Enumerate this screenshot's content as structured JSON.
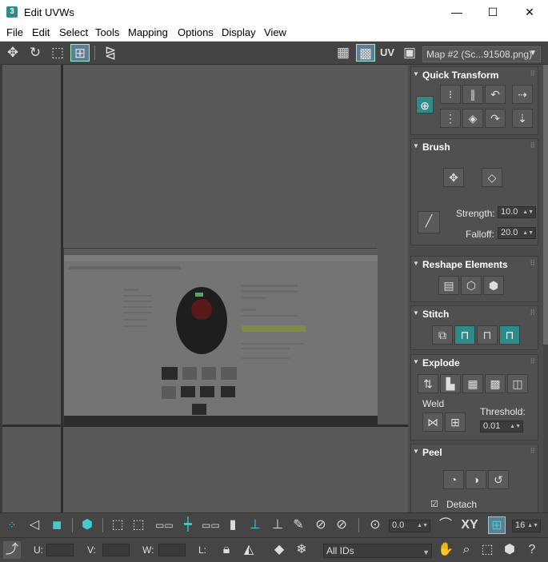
{
  "window": {
    "title": "Edit UVWs",
    "app_icon": "3",
    "minimize": "—",
    "maximize": "☐",
    "close": "✕"
  },
  "menu": [
    "File",
    "Edit",
    "Select",
    "Tools",
    "Mapping",
    "Options",
    "Display",
    "View"
  ],
  "toolbar": {
    "uv_label": "UV",
    "map_dropdown": "Map #2 (Sc...91508.png)"
  },
  "panel": {
    "quick_transform": {
      "title": "Quick Transform"
    },
    "brush": {
      "title": "Brush",
      "strength_label": "Strength:",
      "strength_value": "10.0",
      "falloff_label": "Falloff:",
      "falloff_value": "20.0"
    },
    "reshape": {
      "title": "Reshape Elements"
    },
    "stitch": {
      "title": "Stitch"
    },
    "explode": {
      "title": "Explode",
      "weld_label": "Weld",
      "threshold_label": "Threshold:",
      "threshold_value": "0.01"
    },
    "peel": {
      "title": "Peel",
      "detach_label": "Detach"
    }
  },
  "bottom": {
    "rotation_value": "0.0",
    "xy_label": "XY",
    "grid_value": "16",
    "u_label": "U:",
    "v_label": "V:",
    "w_label": "W:",
    "l_label": "L:",
    "ids_dropdown": "All IDs"
  },
  "colors": {
    "accent": "#2f8a8a",
    "panel_bg": "#4b4b4b",
    "viewport_bg": "#595959"
  }
}
